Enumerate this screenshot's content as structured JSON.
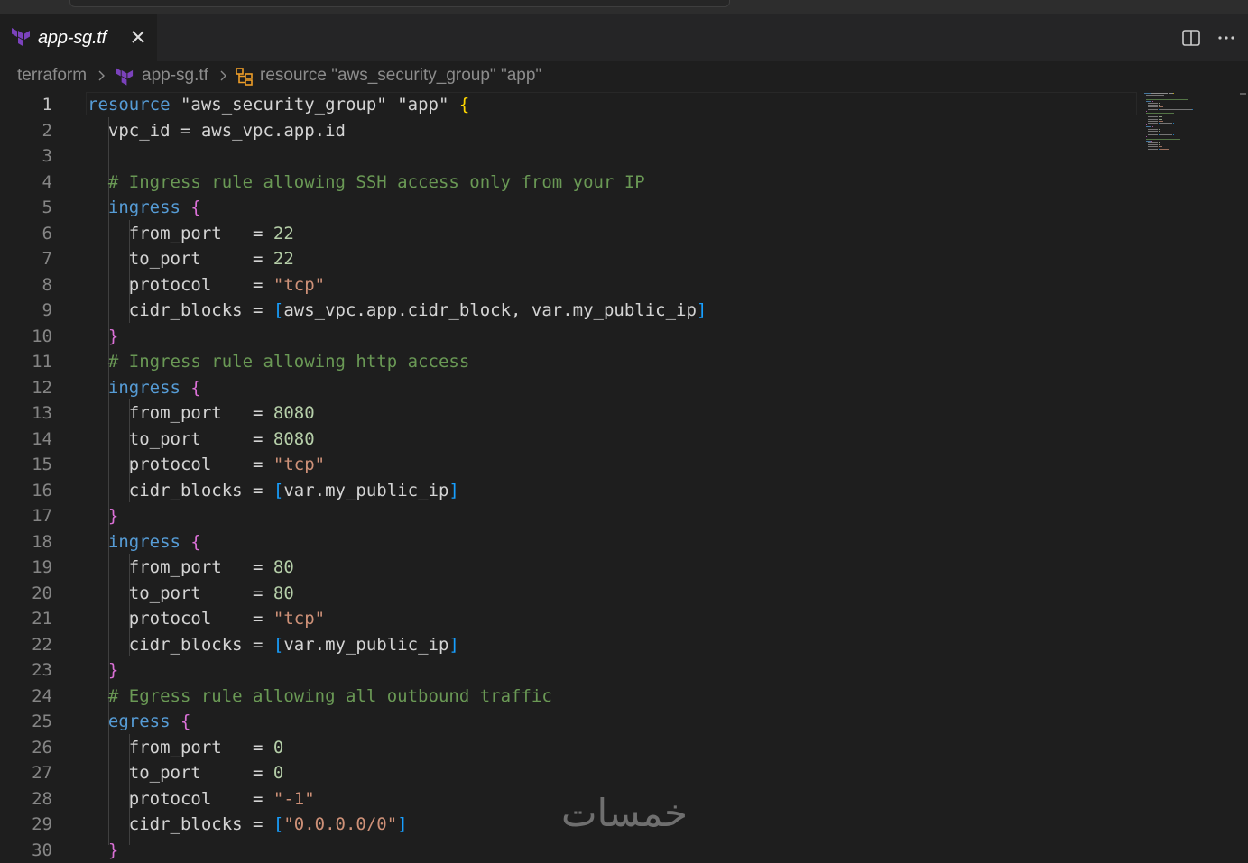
{
  "tab": {
    "label": "app-sg.tf",
    "icon": "terraform-icon",
    "close_icon": "close-icon"
  },
  "actions": {
    "split": "split-editor-icon",
    "more": "more-actions-icon"
  },
  "breadcrumb": {
    "folder": "terraform",
    "file": "app-sg.tf",
    "symbol": "resource \"aws_security_group\" \"app\""
  },
  "colors": {
    "keyword": "#569cd6",
    "string": "#ce9178",
    "number": "#b5cea8",
    "comment": "#6a9955",
    "bracket_1": "#ffd700",
    "bracket_2": "#da70d6",
    "bracket_3": "#179fff",
    "terraform_purple": "#7b42bc"
  },
  "editor": {
    "current_line": 1,
    "lines": [
      {
        "n": "1",
        "segs": [
          [
            "kw",
            "resource"
          ],
          [
            "id",
            " "
          ],
          [
            "strw",
            "\"aws_security_group\""
          ],
          [
            "id",
            " "
          ],
          [
            "strw",
            "\"app\""
          ],
          [
            "id",
            " "
          ],
          [
            "b1",
            "{"
          ]
        ]
      },
      {
        "n": "2",
        "segs": [
          [
            "id",
            "  vpc_id = aws_vpc.app.id"
          ]
        ]
      },
      {
        "n": "3",
        "segs": [
          [
            "id",
            ""
          ]
        ]
      },
      {
        "n": "4",
        "segs": [
          [
            "id",
            "  "
          ],
          [
            "com",
            "# Ingress rule allowing SSH access only from your IP"
          ]
        ]
      },
      {
        "n": "5",
        "segs": [
          [
            "id",
            "  "
          ],
          [
            "kw",
            "ingress"
          ],
          [
            "id",
            " "
          ],
          [
            "b2",
            "{"
          ]
        ]
      },
      {
        "n": "6",
        "segs": [
          [
            "id",
            "    from_port   = "
          ],
          [
            "num",
            "22"
          ]
        ]
      },
      {
        "n": "7",
        "segs": [
          [
            "id",
            "    to_port     = "
          ],
          [
            "num",
            "22"
          ]
        ]
      },
      {
        "n": "8",
        "segs": [
          [
            "id",
            "    protocol    = "
          ],
          [
            "str",
            "\"tcp\""
          ]
        ]
      },
      {
        "n": "9",
        "segs": [
          [
            "id",
            "    cidr_blocks = "
          ],
          [
            "b3",
            "["
          ],
          [
            "id",
            "aws_vpc.app.cidr_block, var.my_public_ip"
          ],
          [
            "b3",
            "]"
          ]
        ]
      },
      {
        "n": "10",
        "segs": [
          [
            "id",
            "  "
          ],
          [
            "b2",
            "}"
          ]
        ]
      },
      {
        "n": "11",
        "segs": [
          [
            "id",
            "  "
          ],
          [
            "com",
            "# Ingress rule allowing http access"
          ]
        ]
      },
      {
        "n": "12",
        "segs": [
          [
            "id",
            "  "
          ],
          [
            "kw",
            "ingress"
          ],
          [
            "id",
            " "
          ],
          [
            "b2",
            "{"
          ]
        ]
      },
      {
        "n": "13",
        "segs": [
          [
            "id",
            "    from_port   = "
          ],
          [
            "num",
            "8080"
          ]
        ]
      },
      {
        "n": "14",
        "segs": [
          [
            "id",
            "    to_port     = "
          ],
          [
            "num",
            "8080"
          ]
        ]
      },
      {
        "n": "15",
        "segs": [
          [
            "id",
            "    protocol    = "
          ],
          [
            "str",
            "\"tcp\""
          ]
        ]
      },
      {
        "n": "16",
        "segs": [
          [
            "id",
            "    cidr_blocks = "
          ],
          [
            "b3",
            "["
          ],
          [
            "id",
            "var.my_public_ip"
          ],
          [
            "b3",
            "]"
          ]
        ]
      },
      {
        "n": "17",
        "segs": [
          [
            "id",
            "  "
          ],
          [
            "b2",
            "}"
          ]
        ]
      },
      {
        "n": "18",
        "segs": [
          [
            "id",
            "  "
          ],
          [
            "kw",
            "ingress"
          ],
          [
            "id",
            " "
          ],
          [
            "b2",
            "{"
          ]
        ]
      },
      {
        "n": "19",
        "segs": [
          [
            "id",
            "    from_port   = "
          ],
          [
            "num",
            "80"
          ]
        ]
      },
      {
        "n": "20",
        "segs": [
          [
            "id",
            "    to_port     = "
          ],
          [
            "num",
            "80"
          ]
        ]
      },
      {
        "n": "21",
        "segs": [
          [
            "id",
            "    protocol    = "
          ],
          [
            "str",
            "\"tcp\""
          ]
        ]
      },
      {
        "n": "22",
        "segs": [
          [
            "id",
            "    cidr_blocks = "
          ],
          [
            "b3",
            "["
          ],
          [
            "id",
            "var.my_public_ip"
          ],
          [
            "b3",
            "]"
          ]
        ]
      },
      {
        "n": "23",
        "segs": [
          [
            "id",
            "  "
          ],
          [
            "b2",
            "}"
          ]
        ]
      },
      {
        "n": "24",
        "segs": [
          [
            "id",
            "  "
          ],
          [
            "com",
            "# Egress rule allowing all outbound traffic"
          ]
        ]
      },
      {
        "n": "25",
        "segs": [
          [
            "id",
            "  "
          ],
          [
            "kw",
            "egress"
          ],
          [
            "id",
            " "
          ],
          [
            "b2",
            "{"
          ]
        ]
      },
      {
        "n": "26",
        "segs": [
          [
            "id",
            "    from_port   = "
          ],
          [
            "num",
            "0"
          ]
        ]
      },
      {
        "n": "27",
        "segs": [
          [
            "id",
            "    to_port     = "
          ],
          [
            "num",
            "0"
          ]
        ]
      },
      {
        "n": "28",
        "segs": [
          [
            "id",
            "    protocol    = "
          ],
          [
            "str",
            "\"-1\""
          ]
        ]
      },
      {
        "n": "29",
        "segs": [
          [
            "id",
            "    cidr_blocks = "
          ],
          [
            "b3",
            "["
          ],
          [
            "str",
            "\"0.0.0.0/0\""
          ],
          [
            "b3",
            "]"
          ]
        ]
      },
      {
        "n": "30",
        "segs": [
          [
            "id",
            "  "
          ],
          [
            "b2",
            "}"
          ]
        ]
      }
    ]
  },
  "watermark": {
    "text": "خمسات"
  }
}
